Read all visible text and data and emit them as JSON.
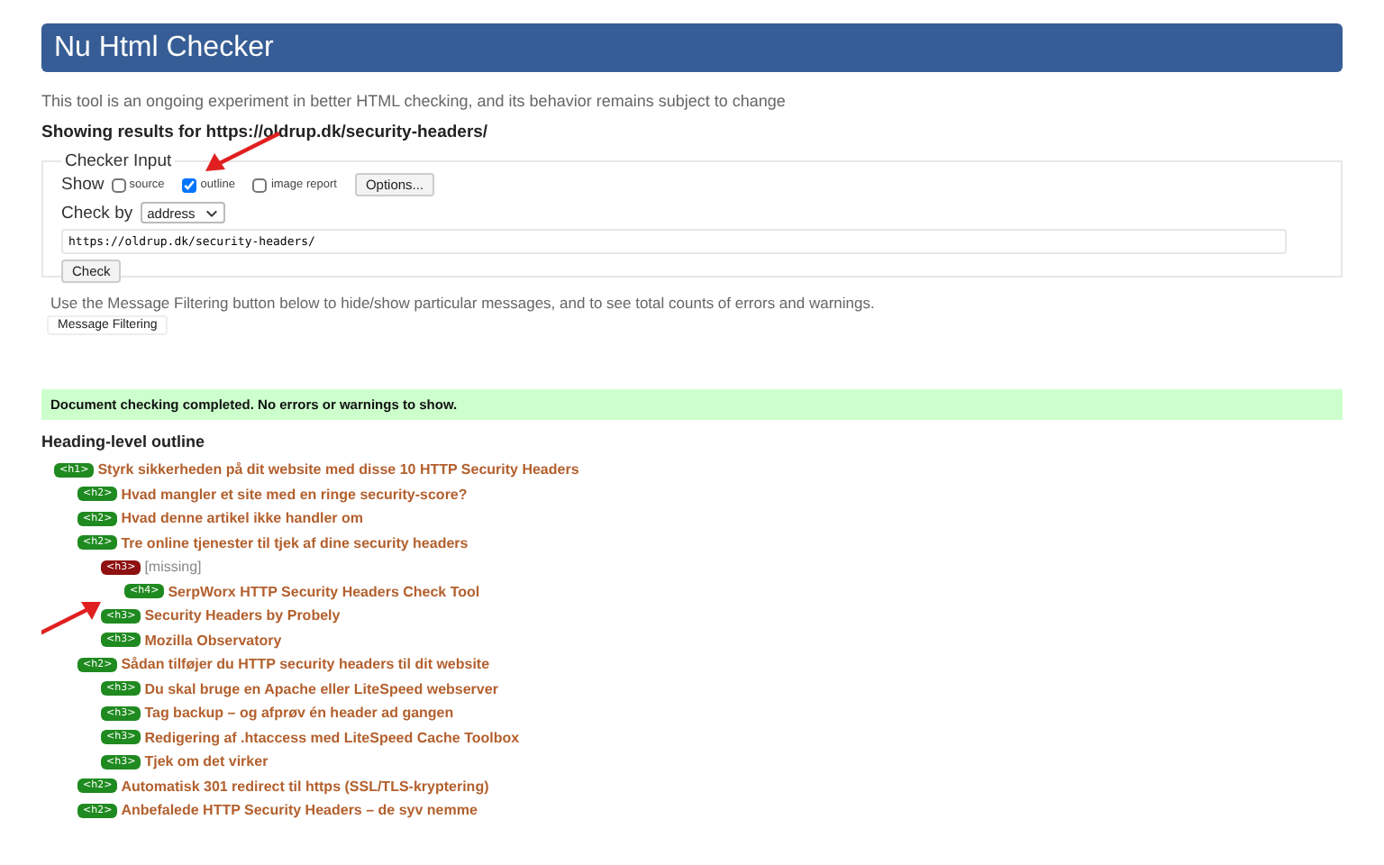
{
  "header": {
    "title": "Nu Html Checker"
  },
  "intro": "This tool is an ongoing experiment in better HTML checking, and its behavior remains subject to change",
  "results_for": "Showing results for https://oldrup.dk/security-headers/",
  "checker_input": {
    "legend": "Checker Input",
    "show_label": "Show",
    "options": [
      {
        "label": "source",
        "checked": false
      },
      {
        "label": "outline",
        "checked": true
      },
      {
        "label": "image report",
        "checked": false
      }
    ],
    "options_button": "Options...",
    "check_by_label": "Check by",
    "check_by_value": "address",
    "url": "https://oldrup.dk/security-headers/",
    "check_button": "Check"
  },
  "filter_note": "Use the Message Filtering button below to hide/show particular messages, and to see total counts of errors and warnings.",
  "filter_button": "Message Filtering",
  "status": "Document checking completed. No errors or warnings to show.",
  "outline": {
    "title": "Heading-level outline",
    "items": [
      {
        "tag": "<h1>",
        "text": "Styrk sikkerheden på dit website med disse 10 HTTP Security Headers",
        "missing": false,
        "children": [
          {
            "tag": "<h2>",
            "text": "Hvad mangler et site med en ringe security-score?",
            "missing": false
          },
          {
            "tag": "<h2>",
            "text": "Hvad denne artikel ikke handler om",
            "missing": false
          },
          {
            "tag": "<h2>",
            "text": "Tre online tjenester til tjek af dine security headers",
            "missing": false,
            "children": [
              {
                "tag": "<h3>",
                "text": "[missing]",
                "missing": true,
                "children": [
                  {
                    "tag": "<h4>",
                    "text": "SerpWorx HTTP Security Headers Check Tool",
                    "missing": false
                  }
                ]
              },
              {
                "tag": "<h3>",
                "text": "Security Headers by Probely",
                "missing": false
              },
              {
                "tag": "<h3>",
                "text": "Mozilla Observatory",
                "missing": false
              }
            ]
          },
          {
            "tag": "<h2>",
            "text": "Sådan tilføjer du HTTP security headers til dit website",
            "missing": false,
            "children": [
              {
                "tag": "<h3>",
                "text": "Du skal bruge en Apache eller LiteSpeed webserver",
                "missing": false
              },
              {
                "tag": "<h3>",
                "text": "Tag backup – og afprøv én header ad gangen",
                "missing": false
              },
              {
                "tag": "<h3>",
                "text": "Redigering af .htaccess med LiteSpeed Cache Toolbox",
                "missing": false
              },
              {
                "tag": "<h3>",
                "text": "Tjek om det virker",
                "missing": false
              }
            ]
          },
          {
            "tag": "<h2>",
            "text": "Automatisk 301 redirect til https (SSL/TLS-kryptering)",
            "missing": false
          },
          {
            "tag": "<h2>",
            "text": "Anbefalede HTTP Security Headers – de syv nemme",
            "missing": false
          }
        ]
      }
    ]
  }
}
